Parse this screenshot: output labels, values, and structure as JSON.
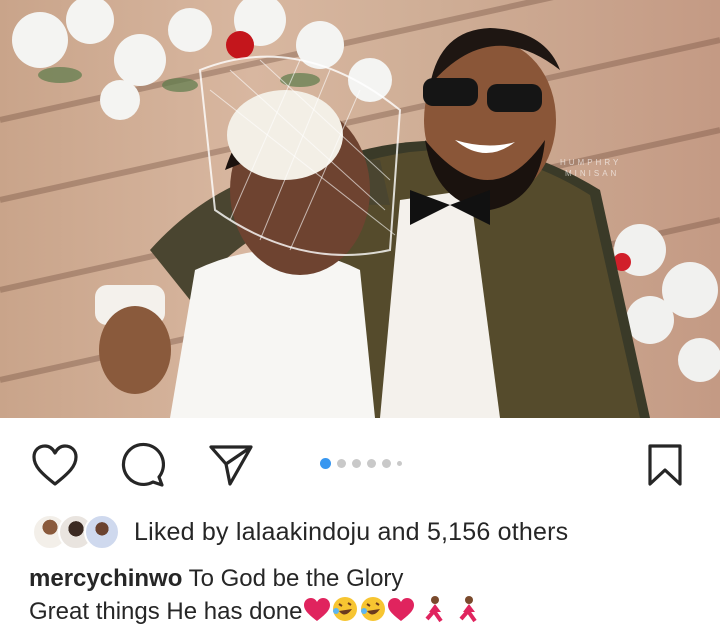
{
  "post": {
    "image_alt": "Wedding couple photo"
  },
  "actions": {
    "like_icon": "heart-icon",
    "comment_icon": "comment-icon",
    "share_icon": "send-icon",
    "save_icon": "bookmark-icon",
    "carousel_total": 6,
    "carousel_active": 1
  },
  "likes": {
    "prefix": "Liked by ",
    "user": "lalaakindoju",
    "middle": " and ",
    "count": "5,156 others"
  },
  "caption": {
    "author": "mercychinwo",
    "line1": " To God be the Glory",
    "line2": "Great things He has done",
    "emojis": [
      "red-heart",
      "rolling-laughing",
      "rolling-laughing",
      "red-heart",
      "dancer",
      "dancer"
    ]
  },
  "colors": {
    "accent": "#3897f0",
    "text": "#262626",
    "dot_inactive": "#c9c9c9",
    "heart": "#e0245e"
  }
}
